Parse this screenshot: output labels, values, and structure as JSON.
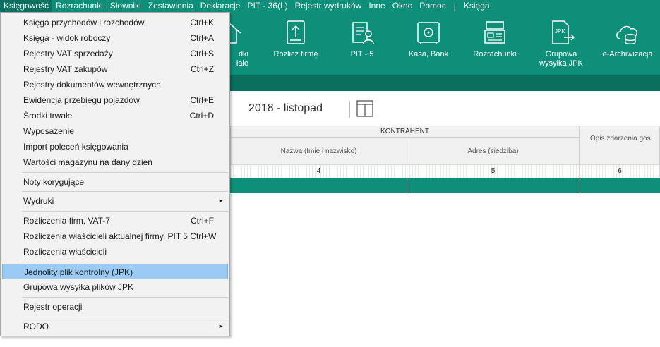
{
  "menubar": {
    "items": [
      "Księgowość",
      "Rozrachunki",
      "Słowniki",
      "Zestawienia",
      "Deklaracje",
      "PIT - 36(L)",
      "Rejestr wydruków",
      "Inne",
      "Okno",
      "Pomoc",
      "Księga"
    ],
    "separator": "|"
  },
  "toolbar": {
    "partial_label_line1": "dki",
    "partial_label_line2": "łałe",
    "items": [
      {
        "label": "Rozlicz firmę"
      },
      {
        "label": "PIT - 5"
      },
      {
        "label": "Kasa, Bank"
      },
      {
        "label": "Rozrachunki"
      },
      {
        "label": "Grupowa",
        "label2": "wysyłka JPK"
      },
      {
        "label": "e-Archiwizacja"
      }
    ]
  },
  "period": "2018 - listopad",
  "table": {
    "group_header": "KONTRAHENT",
    "col_name": "Nazwa (Imię i nazwisko)",
    "col_address": "Adres (siedziba)",
    "col_opis": "Opis zdarzenia gos",
    "num_4": "4",
    "num_5": "5",
    "num_6": "6"
  },
  "dropdown": {
    "items": [
      {
        "label": "Księga przychodów i rozchodów",
        "shortcut": "Ctrl+K"
      },
      {
        "label": "Księga - widok roboczy",
        "shortcut": "Ctrl+A"
      },
      {
        "label": "Rejestry VAT sprzedaży",
        "shortcut": "Ctrl+S"
      },
      {
        "label": "Rejestry VAT zakupów",
        "shortcut": "Ctrl+Z"
      },
      {
        "label": "Rejestry dokumentów wewnętrznych",
        "shortcut": ""
      },
      {
        "label": "Ewidencja przebiegu pojazdów",
        "shortcut": "Ctrl+E"
      },
      {
        "label": "Środki trwałe",
        "shortcut": "Ctrl+D"
      },
      {
        "label": "Wyposażenie",
        "shortcut": ""
      },
      {
        "label": "Import poleceń księgowania",
        "shortcut": ""
      },
      {
        "label": "Wartości magazynu na dany dzień",
        "shortcut": ""
      },
      {
        "label": "Noty korygujące",
        "shortcut": ""
      },
      {
        "label": "Wydruki",
        "shortcut": ""
      },
      {
        "label": "Rozliczenia firm,  VAT-7",
        "shortcut": "Ctrl+F"
      },
      {
        "label": "Rozliczenia właścicieli aktualnej firmy, PIT 5 Ctrl+W",
        "shortcut": ""
      },
      {
        "label": "Rozliczenia właścicieli",
        "shortcut": ""
      },
      {
        "label": "Jednolity plik kontrolny (JPK)",
        "shortcut": ""
      },
      {
        "label": "Grupowa wysyłka plików JPK",
        "shortcut": ""
      },
      {
        "label": "Rejestr operacji",
        "shortcut": ""
      },
      {
        "label": "RODO",
        "shortcut": ""
      }
    ],
    "submenu_arrow": "►"
  },
  "colors": {
    "brand": "#0e8f79",
    "brand_dark": "#0a6e5d",
    "highlight": "#99cbf5"
  }
}
